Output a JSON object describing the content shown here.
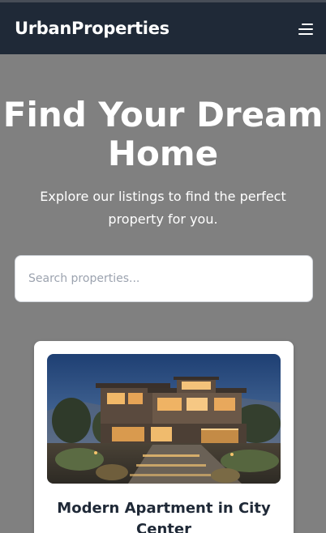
{
  "navbar": {
    "brand": "UrbanProperties",
    "menu_icon": "hamburger-menu-icon"
  },
  "hero": {
    "title": "Find Your Dream Home",
    "subtitle": "Explore our listings to find the perfect property for you."
  },
  "search": {
    "placeholder": "Search properties...",
    "value": ""
  },
  "listings": [
    {
      "title": "Modern Apartment in City Center",
      "image": "modern-house-dusk-photo"
    }
  ],
  "colors": {
    "navbar_bg": "#1f2937",
    "page_bg": "#808080",
    "card_bg": "#ffffff",
    "title_text": "#1f2937"
  }
}
